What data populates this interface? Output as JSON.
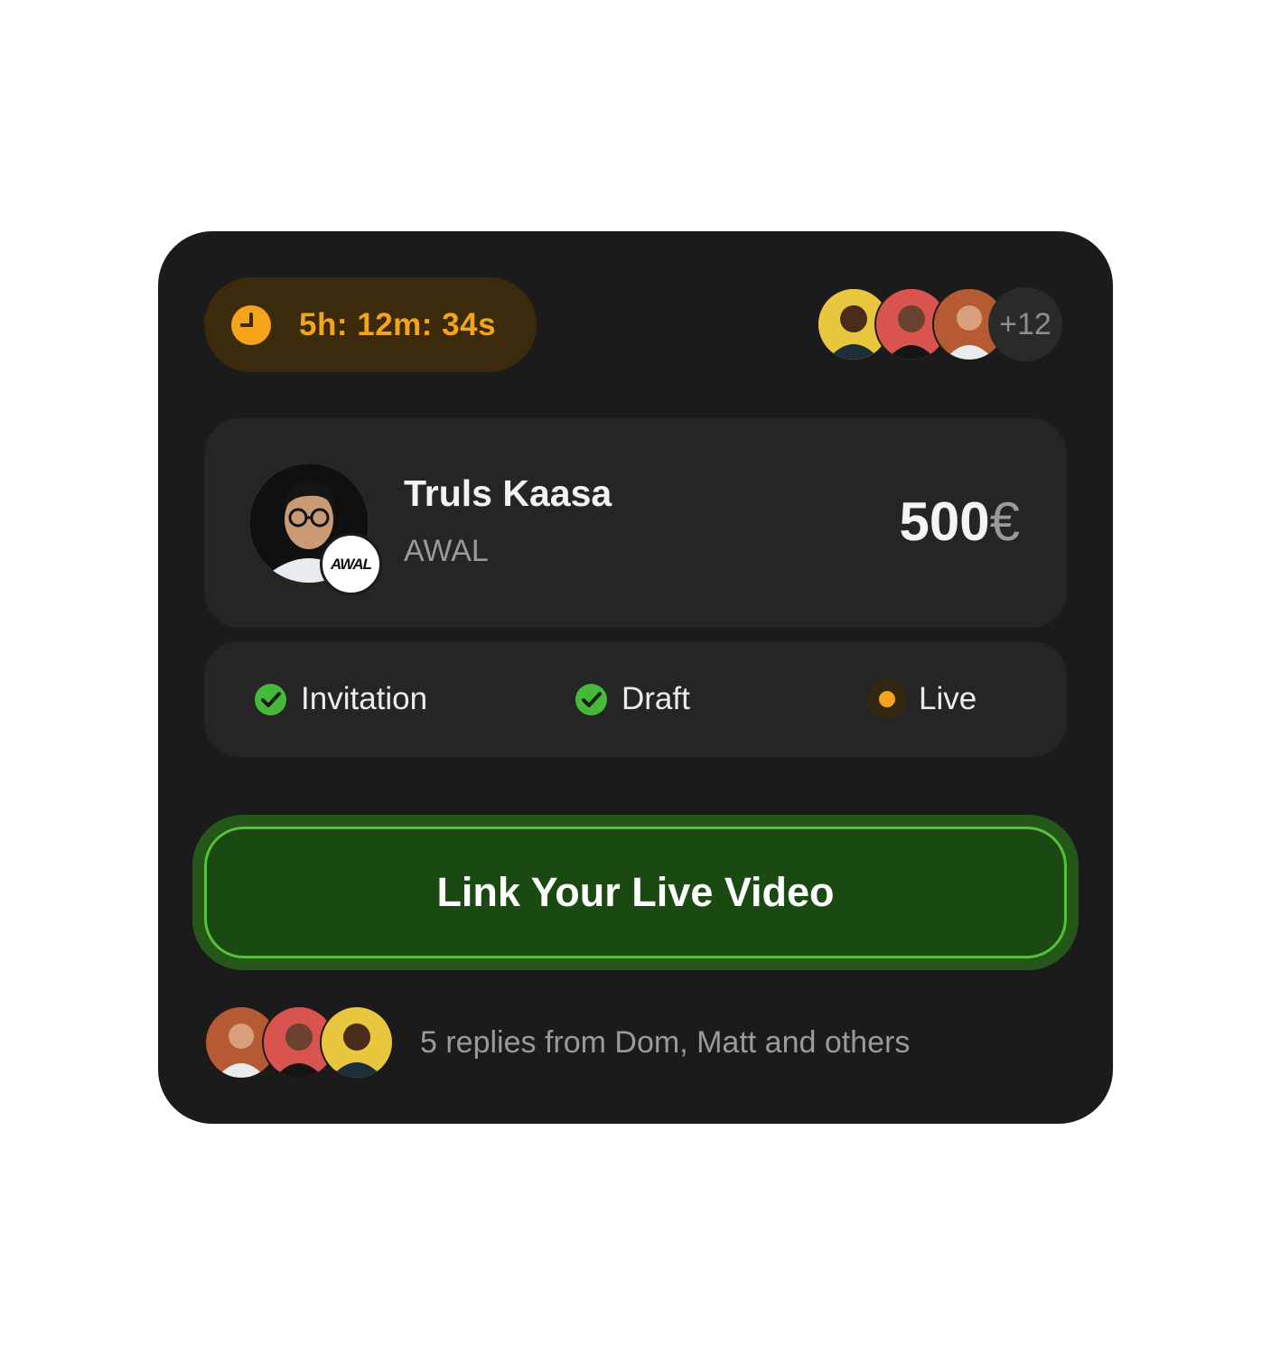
{
  "timer": {
    "icon": "clock-icon",
    "text": "5h: 12m: 34s",
    "color": "#f5a31a"
  },
  "participants": {
    "avatars": [
      {
        "name": "avatar-yellow",
        "bg": "#e8c73f"
      },
      {
        "name": "avatar-red",
        "bg": "#d9534f"
      },
      {
        "name": "avatar-brown",
        "bg": "#b55a33"
      }
    ],
    "more_label": "+12"
  },
  "profile": {
    "name": "Truls Kaasa",
    "label": "AWAL",
    "badge": "AWAL",
    "amount": "500",
    "currency": "€"
  },
  "steps": [
    {
      "label": "Invitation",
      "status": "done",
      "icon": "check-circle-icon"
    },
    {
      "label": "Draft",
      "status": "done",
      "icon": "check-circle-icon"
    },
    {
      "label": "Live",
      "status": "active",
      "icon": "live-dot-icon"
    }
  ],
  "cta": {
    "label": "Link Your Live Video",
    "color": "#1a4a12"
  },
  "replies": {
    "text": "5 replies from Dom, Matt and others"
  }
}
